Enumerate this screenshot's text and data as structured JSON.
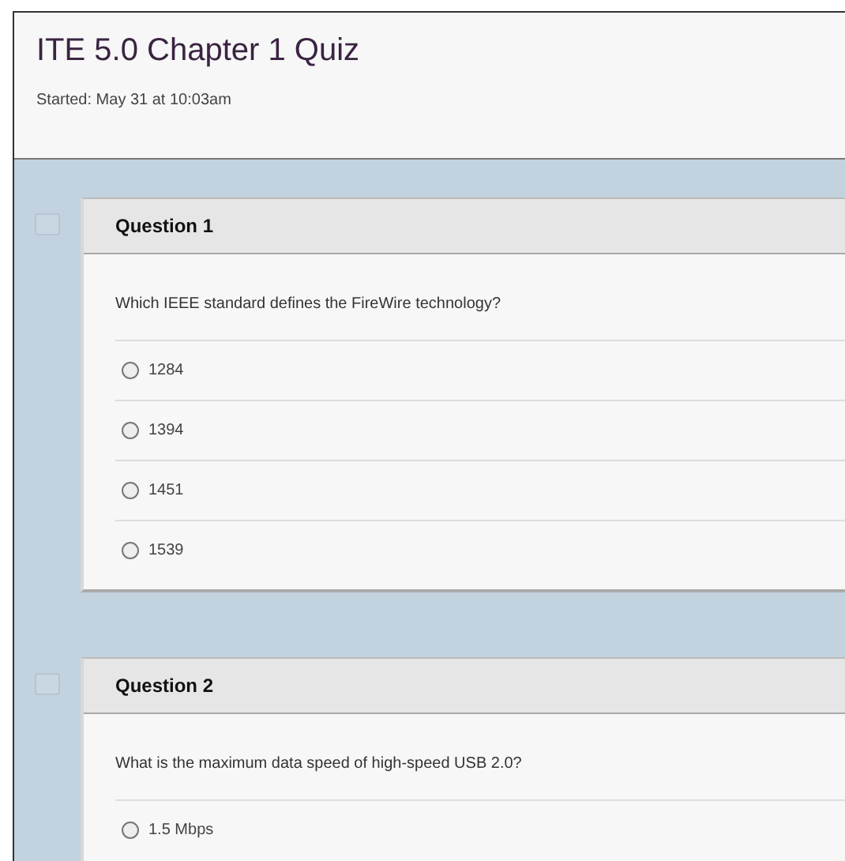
{
  "quiz": {
    "title": "ITE 5.0 Chapter 1 Quiz",
    "started": "Started: May 31 at 10:03am"
  },
  "questions": [
    {
      "heading": "Question 1",
      "text": "Which IEEE standard defines the FireWire technology?",
      "flagged": false,
      "options": [
        {
          "label": "1284",
          "selected": false
        },
        {
          "label": "1394",
          "selected": false
        },
        {
          "label": "1451",
          "selected": false
        },
        {
          "label": "1539",
          "selected": false
        }
      ]
    },
    {
      "heading": "Question 2",
      "text": "What is the maximum data speed of high-speed USB 2.0?",
      "flagged": false,
      "options": [
        {
          "label": "1.5 Mbps",
          "selected": false
        }
      ]
    }
  ]
}
